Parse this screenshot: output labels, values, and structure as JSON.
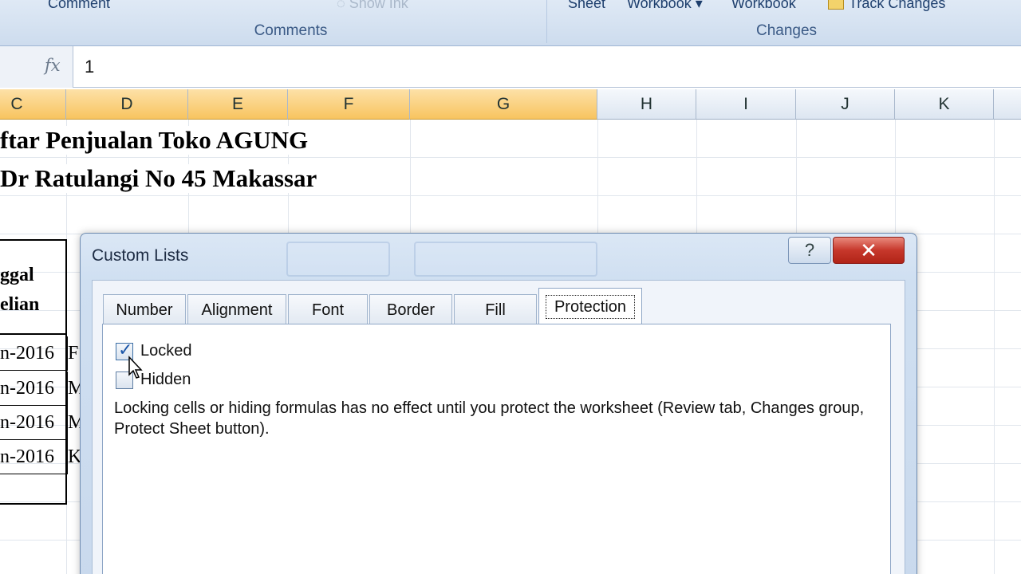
{
  "ribbon": {
    "comment_label": "Comment",
    "show_ink_label": "Show Ink",
    "comments_group": "Comments",
    "sheet_label": "Sheet",
    "workbook_label_1": "Workbook",
    "workbook_label_2": "Workbook",
    "track_changes_label": "Track Changes",
    "changes_group": "Changes"
  },
  "formula_bar": {
    "fx_icon": "fx",
    "value": "1"
  },
  "columns": [
    "C",
    "D",
    "E",
    "F",
    "G",
    "H",
    "I",
    "J",
    "K"
  ],
  "sheet": {
    "title_line1": "ftar Penjualan Toko AGUNG",
    "title_line2": "Dr Ratulangi No 45 Makassar",
    "header_line1": "ggal",
    "header_line2": "elian",
    "rows": [
      {
        "date": "n-2016",
        "next": "F"
      },
      {
        "date": "n-2016",
        "next": "M"
      },
      {
        "date": "n-2016",
        "next": "M"
      },
      {
        "date": "n-2016",
        "next": "K"
      }
    ]
  },
  "dialog": {
    "title": "Custom Lists",
    "help_label": "?",
    "close_label": "✕",
    "tabs": [
      {
        "label": "Number"
      },
      {
        "label": "Alignment"
      },
      {
        "label": "Font"
      },
      {
        "label": "Border"
      },
      {
        "label": "Fill"
      },
      {
        "label": "Protection"
      }
    ],
    "active_tab": "Protection",
    "locked_label": "Locked",
    "locked_checked": true,
    "hidden_label": "Hidden",
    "hidden_checked": false,
    "note": "Locking cells or hiding formulas has no effect until you protect the worksheet (Review tab, Changes group, Protect Sheet button)."
  },
  "colors": {
    "selected_column": "#f8c45f",
    "close_button": "#c6372b",
    "dialog_frame": "#cfdff1"
  }
}
